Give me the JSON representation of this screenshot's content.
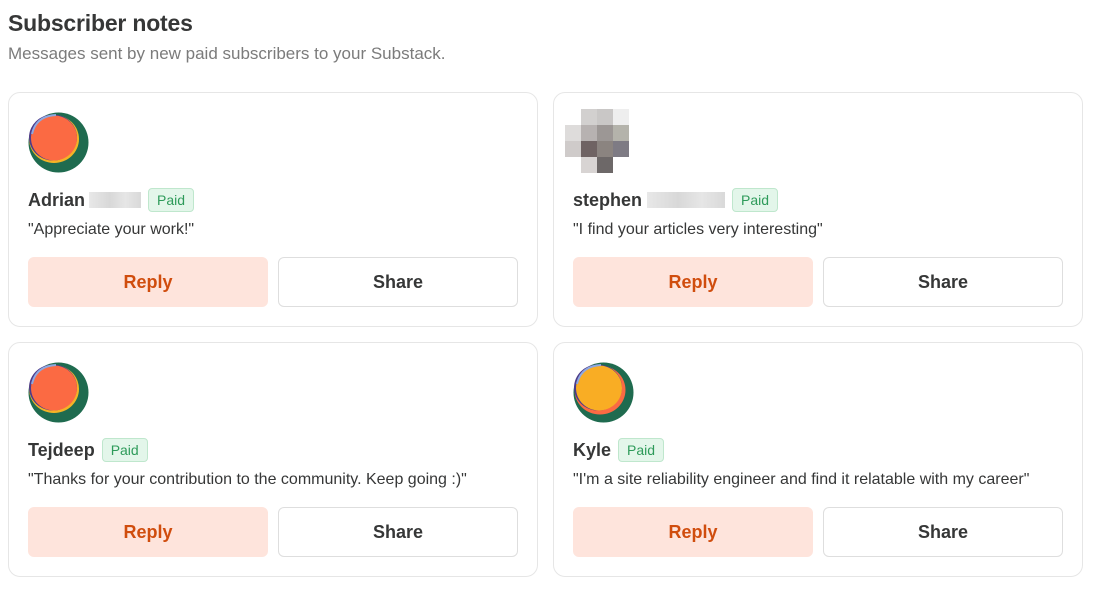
{
  "header": {
    "title": "Subscriber notes",
    "subtitle": "Messages sent by new paid subscribers to your Substack."
  },
  "notes": [
    {
      "name": "Adrian",
      "badge": "Paid",
      "message": "\"Appreciate your work!\"",
      "avatar": "orange-green-circle-avatar",
      "reply_label": "Reply",
      "share_label": "Share"
    },
    {
      "name": "stephen",
      "badge": "Paid",
      "message": "\"I find your articles very interesting\"",
      "avatar": "pixelated-photo-avatar",
      "reply_label": "Reply",
      "share_label": "Share"
    },
    {
      "name": "Tejdeep",
      "badge": "Paid",
      "message": "\"Thanks for your contribution to the community. Keep going :)\"",
      "avatar": "orange-green-circle-avatar",
      "reply_label": "Reply",
      "share_label": "Share"
    },
    {
      "name": "Kyle",
      "badge": "Paid",
      "message": "\"I'm a site reliability engineer and find it relatable with my career\"",
      "avatar": "yellow-orange-circle-avatar",
      "reply_label": "Reply",
      "share_label": "Share"
    }
  ],
  "colors": {
    "accent": "#d04d0e",
    "reply_bg": "#fee4dc",
    "badge_text": "#2e9b5a",
    "badge_bg": "#e3f6ea"
  }
}
